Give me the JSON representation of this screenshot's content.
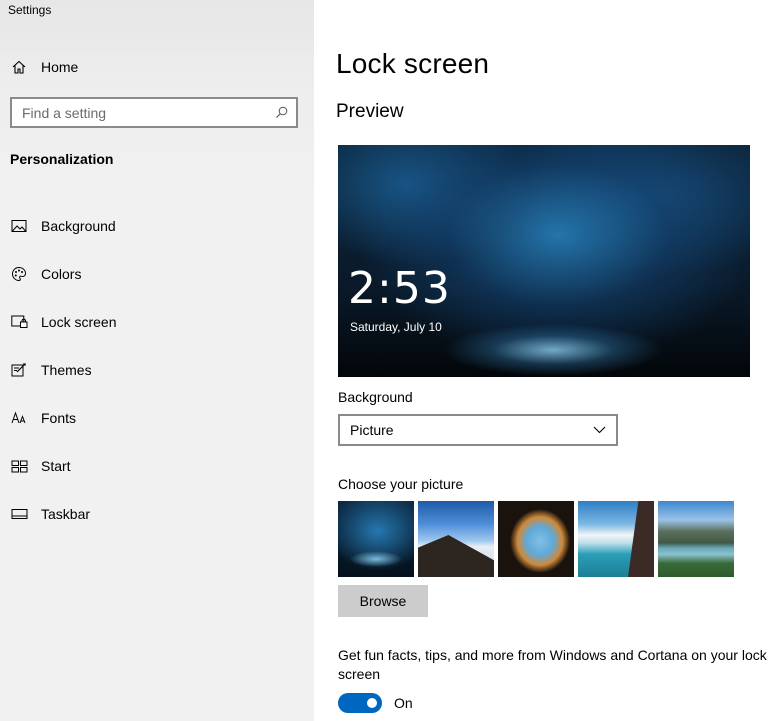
{
  "window": {
    "title": "Settings"
  },
  "sidebar": {
    "home": {
      "label": "Home",
      "icon": "home-icon"
    },
    "search": {
      "placeholder": "Find a setting",
      "icon": "search-icon"
    },
    "section": "Personalization",
    "items": [
      {
        "label": "Background",
        "icon": "picture-icon"
      },
      {
        "label": "Colors",
        "icon": "palette-icon"
      },
      {
        "label": "Lock screen",
        "icon": "lock-screen-icon"
      },
      {
        "label": "Themes",
        "icon": "themes-icon"
      },
      {
        "label": "Fonts",
        "icon": "fonts-icon"
      },
      {
        "label": "Start",
        "icon": "start-icon"
      },
      {
        "label": "Taskbar",
        "icon": "taskbar-icon"
      }
    ]
  },
  "main": {
    "title": "Lock screen",
    "preview": {
      "heading": "Preview",
      "time": "2:53",
      "date": "Saturday, July 10"
    },
    "background": {
      "label": "Background",
      "value": "Picture",
      "icon": "chevron-down-icon"
    },
    "choose_picture": {
      "label": "Choose your picture",
      "browse_label": "Browse"
    },
    "fun_facts": {
      "text": "Get fun facts, tips, and more from Windows and Cortana on your lock screen",
      "toggle_state": "On",
      "toggle_on": true,
      "accent": "#0067c0"
    }
  }
}
